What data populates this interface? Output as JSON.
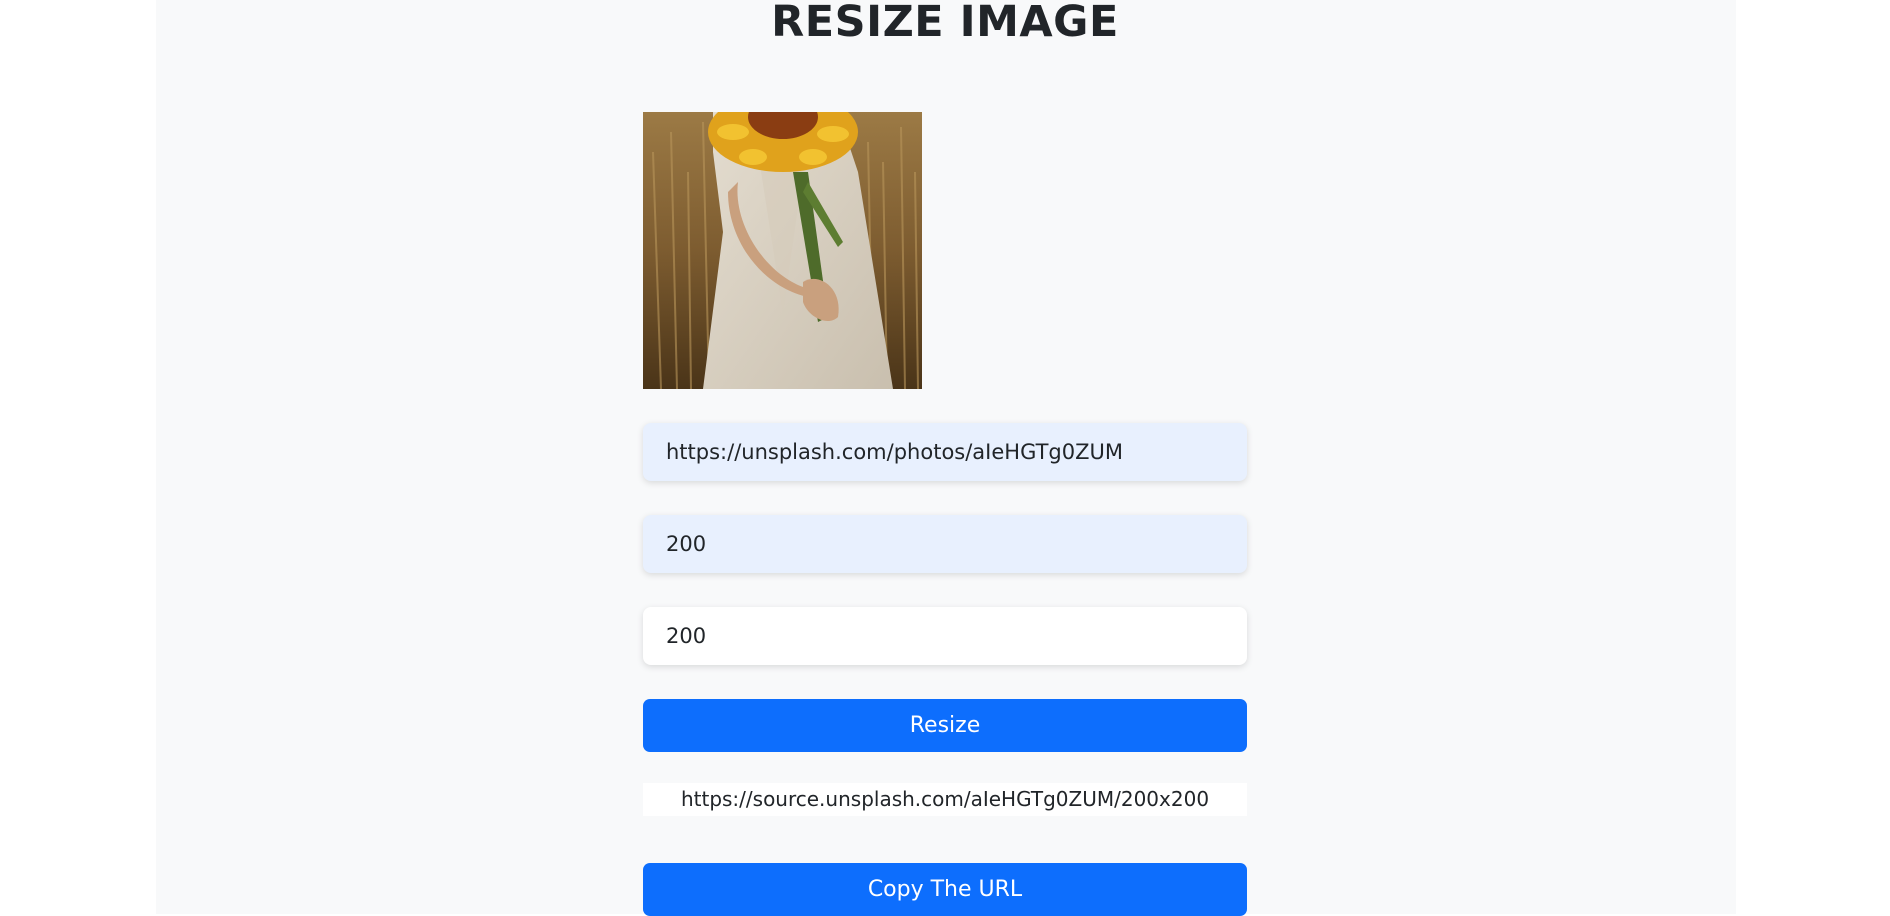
{
  "page": {
    "title": "RESIZE IMAGE"
  },
  "preview": {
    "alt_description": "sunflower-field-photo"
  },
  "form": {
    "url_input": {
      "value": "https://unsplash.com/photos/aIeHGTg0ZUM"
    },
    "width_input": {
      "value": "200"
    },
    "height_input": {
      "value": "200"
    },
    "resize_label": "Resize"
  },
  "result": {
    "url_text": "https://source.unsplash.com/aIeHGTg0ZUM/200x200",
    "copy_label": "Copy The URL"
  },
  "colors": {
    "accent": "#0d6efd",
    "page_background": "#f8f9fa",
    "autofill_background": "#e8f0fe"
  }
}
